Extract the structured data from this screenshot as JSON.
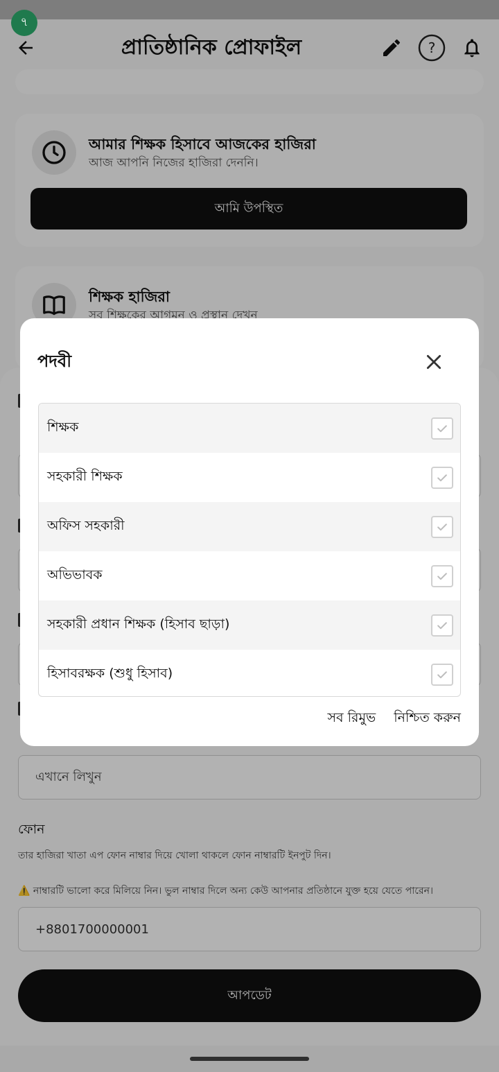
{
  "status": {
    "badge": "৭"
  },
  "header": {
    "title": "প্রাতিষ্ঠানিক প্রোফাইল"
  },
  "cards": {
    "attendance": {
      "title": "আমার শিক্ষক হিসাবে আজকের হাজিরা",
      "subtitle": "আজ আপনি নিজের হাজিরা দেননি।",
      "button": "আমি উপস্থিত"
    },
    "teacher_attendance": {
      "title": "শিক্ষক হাজিরা",
      "subtitle": "সব শিক্ষকের আগমন ও প্রস্থান দেখুন"
    }
  },
  "form": {
    "write_placeholder": "এখানে লিখুন",
    "phone_label": "ফোন",
    "phone_hint": "তার হাজিরা খাতা এপ ফোন নাম্বার দিয়ে খোলা থাকলে ফোন নাম্বারটি ইনপুট দিন।",
    "warning_icon": "⚠️",
    "phone_warning": "নাম্বারটি ভালো করে মিলিয়ে নিন। ভুল নাম্বার দিলে অন্য কেউ আপনার প্রতিষ্ঠানে যুক্ত হয়ে যেতে পারেন।",
    "phone_value": "+8801700000001",
    "update_button": "আপডেট"
  },
  "dialog": {
    "title": "পদবী",
    "options": [
      {
        "label": "শিক্ষক",
        "checked": false
      },
      {
        "label": "সহকারী শিক্ষক",
        "checked": false
      },
      {
        "label": "অফিস সহকারী",
        "checked": false
      },
      {
        "label": "অভিভাবক",
        "checked": false
      },
      {
        "label": "সহকারী প্রধান শিক্ষক (হিসাব ছাড়া)",
        "checked": false
      },
      {
        "label": "হিসাবরক্ষক (শুধু হিসাব)",
        "checked": false
      }
    ],
    "remove_all": "সব রিমুভ",
    "confirm": "নিশ্চিত করুন"
  },
  "colors": {
    "accent_dark": "#111111",
    "badge_green": "#1f7a4d"
  }
}
